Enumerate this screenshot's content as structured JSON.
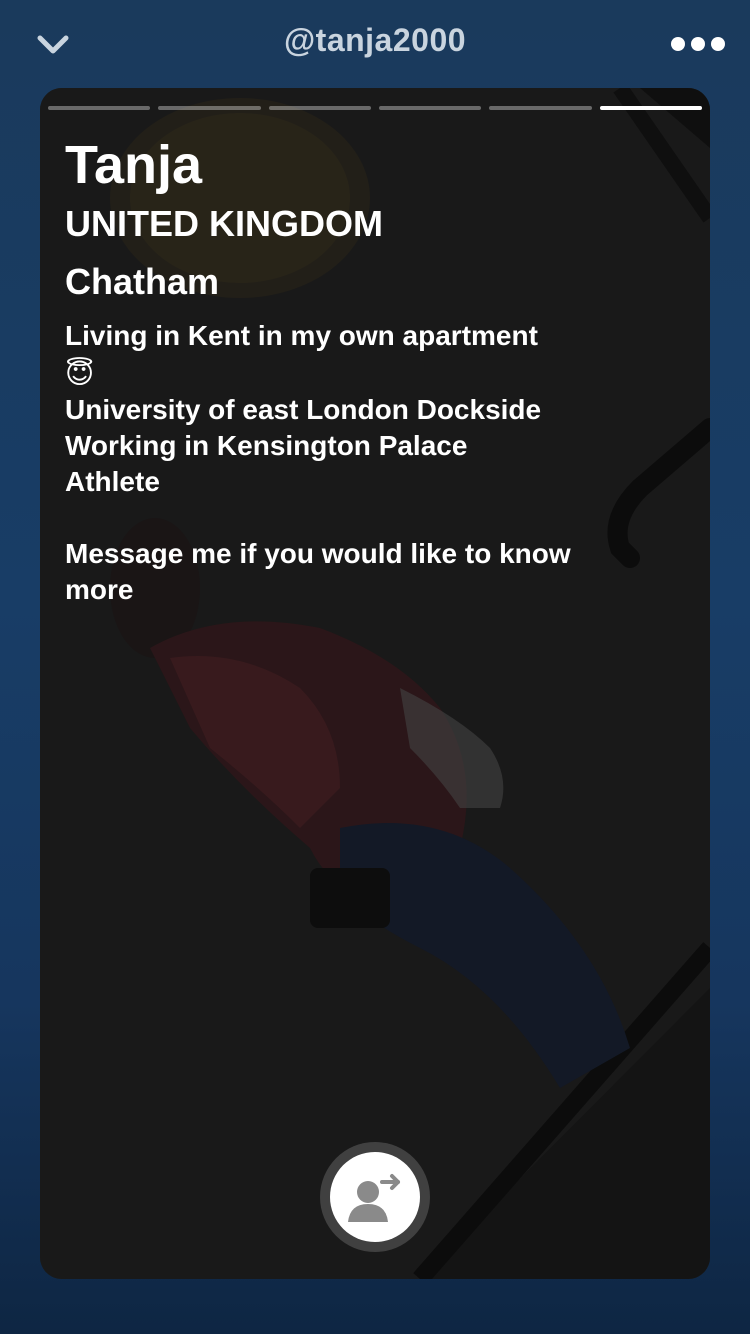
{
  "header": {
    "username": "@tanja2000",
    "back_icon": "chevron-down-icon",
    "more_icon": "more-dots-icon"
  },
  "story": {
    "segment_count": 6,
    "active_segment": 6
  },
  "profile": {
    "name": "Tanja",
    "country": "UNITED KINGDOM",
    "city": "Chatham",
    "bio_line_1": "Living in Kent in my own apartment",
    "bio_emoji": "😇",
    "bio_rest": "University of east London Dockside\nWorking in Kensington Palace\nAthlete\n\nMessage me if you would like to know more"
  },
  "action": {
    "icon": "add-contact-icon"
  },
  "colors": {
    "background": "#183d66",
    "header_text": "#c9d4df",
    "overlay_text": "#ffffff",
    "progress_active": "#ffffff",
    "progress_inactive": "rgba(255,255,255,0.35)"
  }
}
